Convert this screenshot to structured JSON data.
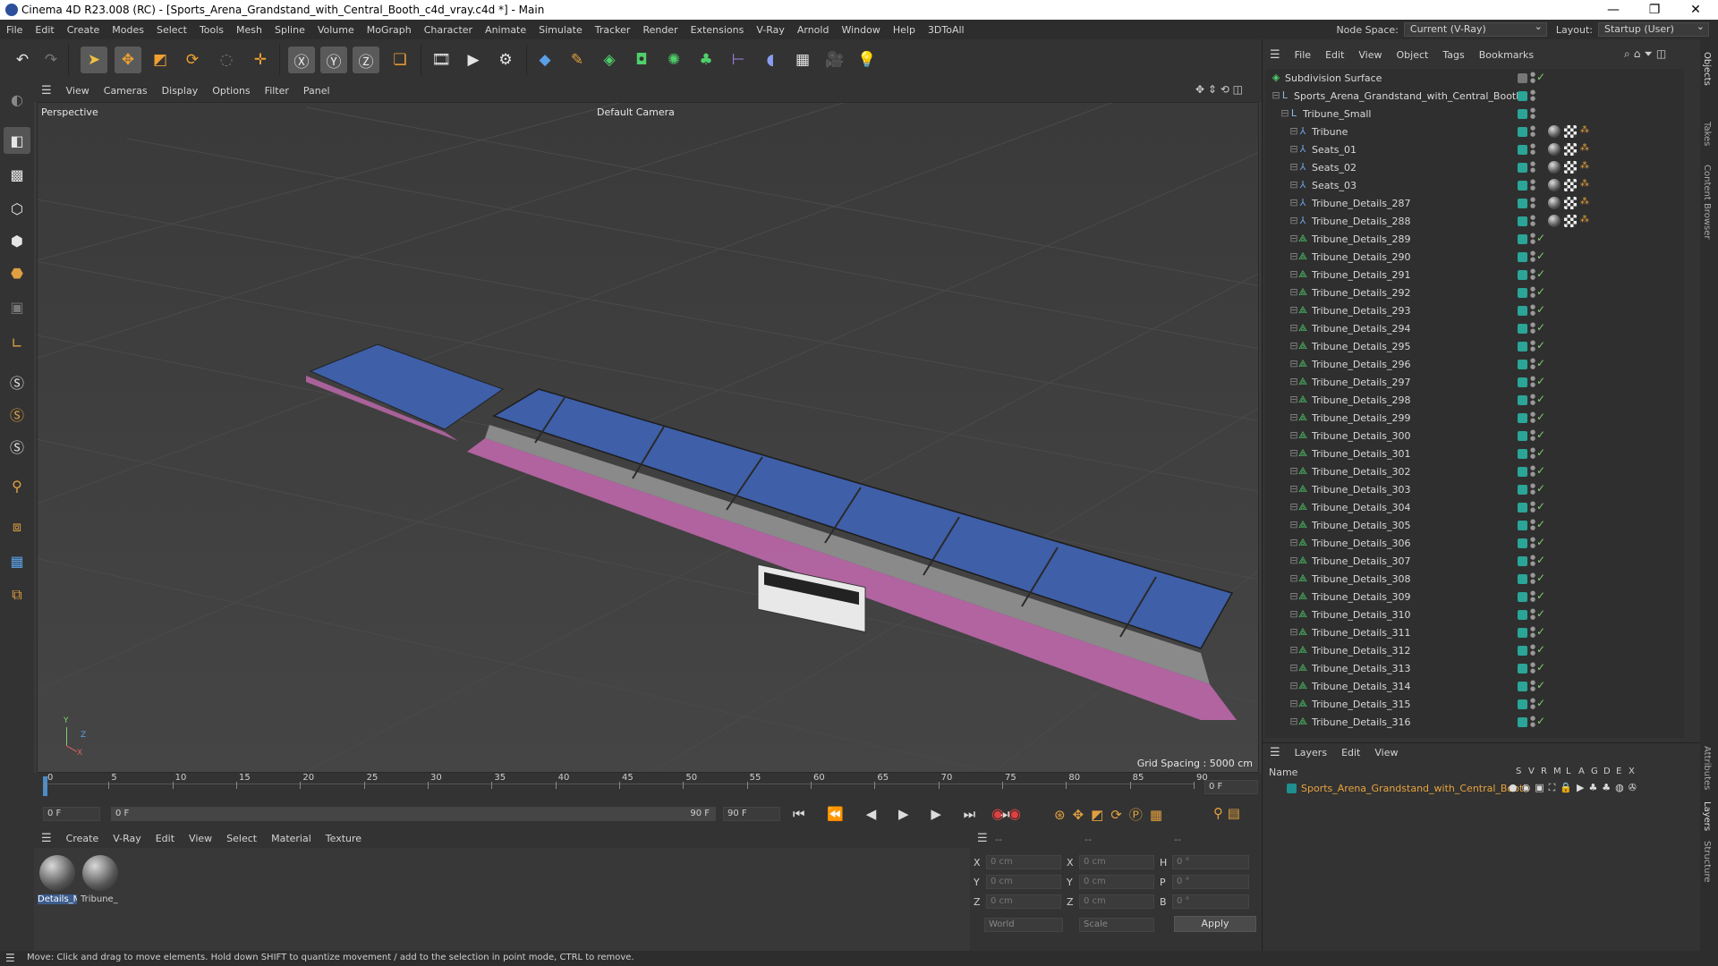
{
  "window": {
    "title": "Cinema 4D R23.008 (RC) - [Sports_Arena_Grandstand_with_Central_Booth_c4d_vray.c4d *] - Main",
    "minimize": "—",
    "maximize": "❐",
    "close": "✕"
  },
  "menubar": {
    "items": [
      "File",
      "Edit",
      "Create",
      "Modes",
      "Select",
      "Tools",
      "Mesh",
      "Spline",
      "Volume",
      "MoGraph",
      "Character",
      "Animate",
      "Simulate",
      "Tracker",
      "Render",
      "Extensions",
      "V-Ray",
      "Arnold",
      "Window",
      "Help",
      "3DToAll"
    ],
    "node_space_label": "Node Space:",
    "node_space_value": "Current (V-Ray)",
    "layout_label": "Layout:",
    "layout_value": "Startup (User)"
  },
  "viewport": {
    "menu": [
      "View",
      "Cameras",
      "Display",
      "Options",
      "Filter",
      "Panel"
    ],
    "view_name": "Perspective",
    "camera": "Default Camera",
    "grid_spacing": "Grid Spacing : 5000 cm",
    "axis_x": "X",
    "axis_y": "Y",
    "axis_z": "Z"
  },
  "timeline": {
    "ticks": [
      "0",
      "5",
      "10",
      "15",
      "20",
      "25",
      "30",
      "35",
      "40",
      "45",
      "50",
      "55",
      "60",
      "65",
      "70",
      "75",
      "80",
      "85",
      "90"
    ],
    "current_frame": "0 F",
    "start_field": "0 F",
    "range_start": "0 F",
    "range_end": "90 F",
    "end_field": "90 F",
    "end_field2": "90 F"
  },
  "materials": {
    "menu": [
      "Create",
      "V-Ray",
      "Edit",
      "View",
      "Select",
      "Material",
      "Texture"
    ],
    "items": [
      {
        "name": "Details_M"
      },
      {
        "name": "Tribune_"
      }
    ]
  },
  "attributes": {
    "header": [
      "--",
      "--",
      "--"
    ],
    "rows": [
      {
        "a": "X",
        "av": "0 cm",
        "b": "X",
        "bv": "0 cm",
        "c": "H",
        "cv": "0 °"
      },
      {
        "a": "Y",
        "av": "0 cm",
        "b": "Y",
        "bv": "0 cm",
        "c": "P",
        "cv": "0 °"
      },
      {
        "a": "Z",
        "av": "0 cm",
        "b": "Z",
        "bv": "0 cm",
        "c": "B",
        "cv": "0 °"
      }
    ],
    "coord_mode": "World",
    "scale_mode": "Scale",
    "apply": "Apply"
  },
  "status": "Move: Click and drag to move elements. Hold down SHIFT to quantize movement / add to the selection in point mode, CTRL to remove.",
  "objects": {
    "menu": [
      "File",
      "Edit",
      "View",
      "Object",
      "Tags",
      "Bookmarks"
    ],
    "rows": [
      {
        "name": "Subdivision Surface",
        "kind": "subdiv",
        "indent": 0
      },
      {
        "name": "Sports_Arena_Grandstand_with_Central_Booth",
        "kind": "null",
        "indent": 1
      },
      {
        "name": "Tribune_Small",
        "kind": "null",
        "indent": 2
      },
      {
        "name": "Tribune",
        "kind": "joint",
        "indent": 3,
        "tags": true
      },
      {
        "name": "Seats_01",
        "kind": "joint",
        "indent": 3,
        "tags": true
      },
      {
        "name": "Seats_02",
        "kind": "joint",
        "indent": 3,
        "tags": true
      },
      {
        "name": "Seats_03",
        "kind": "joint",
        "indent": 3,
        "tags": true
      },
      {
        "name": "Tribune_Details_287",
        "kind": "joint",
        "indent": 3,
        "tags": true
      },
      {
        "name": "Tribune_Details_288",
        "kind": "joint",
        "indent": 3,
        "tags": true
      },
      {
        "name": "Tribune_Details_289",
        "kind": "bone",
        "indent": 3
      },
      {
        "name": "Tribune_Details_290",
        "kind": "bone",
        "indent": 3
      },
      {
        "name": "Tribune_Details_291",
        "kind": "bone",
        "indent": 3
      },
      {
        "name": "Tribune_Details_292",
        "kind": "bone",
        "indent": 3
      },
      {
        "name": "Tribune_Details_293",
        "kind": "bone",
        "indent": 3
      },
      {
        "name": "Tribune_Details_294",
        "kind": "bone",
        "indent": 3
      },
      {
        "name": "Tribune_Details_295",
        "kind": "bone",
        "indent": 3
      },
      {
        "name": "Tribune_Details_296",
        "kind": "bone",
        "indent": 3
      },
      {
        "name": "Tribune_Details_297",
        "kind": "bone",
        "indent": 3
      },
      {
        "name": "Tribune_Details_298",
        "kind": "bone",
        "indent": 3
      },
      {
        "name": "Tribune_Details_299",
        "kind": "bone",
        "indent": 3
      },
      {
        "name": "Tribune_Details_300",
        "kind": "bone",
        "indent": 3
      },
      {
        "name": "Tribune_Details_301",
        "kind": "bone",
        "indent": 3
      },
      {
        "name": "Tribune_Details_302",
        "kind": "bone",
        "indent": 3
      },
      {
        "name": "Tribune_Details_303",
        "kind": "bone",
        "indent": 3
      },
      {
        "name": "Tribune_Details_304",
        "kind": "bone",
        "indent": 3
      },
      {
        "name": "Tribune_Details_305",
        "kind": "bone",
        "indent": 3
      },
      {
        "name": "Tribune_Details_306",
        "kind": "bone",
        "indent": 3
      },
      {
        "name": "Tribune_Details_307",
        "kind": "bone",
        "indent": 3
      },
      {
        "name": "Tribune_Details_308",
        "kind": "bone",
        "indent": 3
      },
      {
        "name": "Tribune_Details_309",
        "kind": "bone",
        "indent": 3
      },
      {
        "name": "Tribune_Details_310",
        "kind": "bone",
        "indent": 3
      },
      {
        "name": "Tribune_Details_311",
        "kind": "bone",
        "indent": 3
      },
      {
        "name": "Tribune_Details_312",
        "kind": "bone",
        "indent": 3
      },
      {
        "name": "Tribune_Details_313",
        "kind": "bone",
        "indent": 3
      },
      {
        "name": "Tribune_Details_314",
        "kind": "bone",
        "indent": 3
      },
      {
        "name": "Tribune_Details_315",
        "kind": "bone",
        "indent": 3
      },
      {
        "name": "Tribune_Details_316",
        "kind": "bone",
        "indent": 3
      }
    ]
  },
  "layers": {
    "menu": [
      "Layers",
      "Edit",
      "View"
    ],
    "header_name": "Name",
    "header_cols": [
      "S",
      "V",
      "R",
      "M",
      "L",
      "A",
      "G",
      "D",
      "E",
      "X"
    ],
    "row_name": "Sports_Arena_Grandstand_with_Central_Booth",
    "row_color": "#1f8f8f"
  },
  "side_tabs": [
    "Objects",
    "Takes",
    "Content Browser",
    "Attributes",
    "Layers",
    "Structure"
  ],
  "colors": {
    "accent_orange": "#e8a33d",
    "seat_blue": "#3f5fa8",
    "frame_pink": "#c46ab0",
    "check_green": "#7fd06f",
    "layer_text": "#e8a33d"
  }
}
